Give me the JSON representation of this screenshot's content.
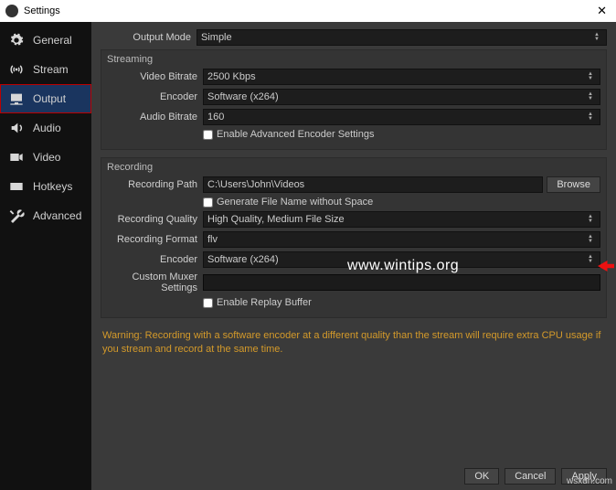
{
  "window": {
    "title": "Settings"
  },
  "sidebar": {
    "items": [
      {
        "label": "General"
      },
      {
        "label": "Stream"
      },
      {
        "label": "Output"
      },
      {
        "label": "Audio"
      },
      {
        "label": "Video"
      },
      {
        "label": "Hotkeys"
      },
      {
        "label": "Advanced"
      }
    ]
  },
  "output_mode": {
    "label": "Output Mode",
    "value": "Simple"
  },
  "streaming": {
    "title": "Streaming",
    "video_bitrate": {
      "label": "Video Bitrate",
      "value": "2500 Kbps"
    },
    "encoder": {
      "label": "Encoder",
      "value": "Software (x264)"
    },
    "audio_bitrate": {
      "label": "Audio Bitrate",
      "value": "160"
    },
    "adv_enc": {
      "label": "Enable Advanced Encoder Settings"
    }
  },
  "recording": {
    "title": "Recording",
    "path": {
      "label": "Recording Path",
      "value": "C:\\Users\\John\\Videos",
      "browse": "Browse"
    },
    "gen_no_space": {
      "label": "Generate File Name without Space"
    },
    "quality": {
      "label": "Recording Quality",
      "value": "High Quality, Medium File Size"
    },
    "format": {
      "label": "Recording Format",
      "value": "flv"
    },
    "encoder": {
      "label": "Encoder",
      "value": "Software (x264)"
    },
    "muxer": {
      "label": "Custom Muxer Settings"
    },
    "replay": {
      "label": "Enable Replay Buffer"
    }
  },
  "warning": "Warning: Recording with a software encoder at a different quality than the stream will require extra CPU usage if you stream and record at the same time.",
  "buttons": {
    "ok": "OK",
    "cancel": "Cancel",
    "apply": "Apply"
  },
  "watermark": "www.wintips.org",
  "wm2": "wsxdn.com"
}
